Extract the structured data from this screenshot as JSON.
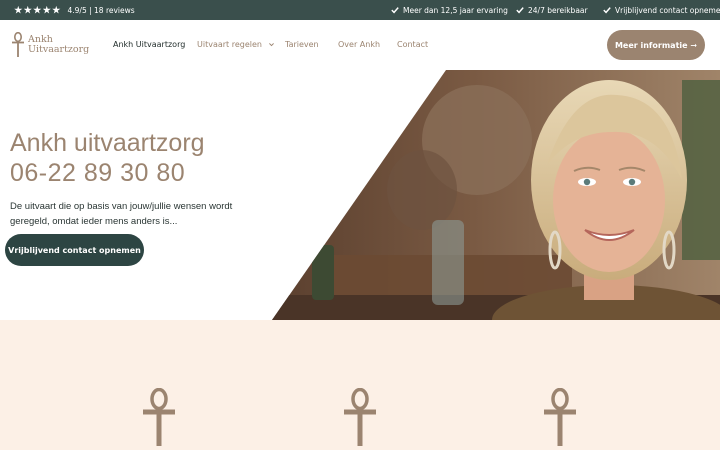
{
  "topbar": {
    "rating_text": "4.9/5 | 18 reviews",
    "stars": 5,
    "usps": [
      "Meer dan 12,5 jaar ervaring",
      "24/7 bereikbaar",
      "Vrijblijvend contact opnemen"
    ]
  },
  "logo": {
    "line1": "Ankh",
    "line2": "Uitvaartzorg"
  },
  "nav": {
    "items": [
      {
        "label": "Ankh Uitvaartzorg"
      },
      {
        "label": "Uitvaart regelen"
      },
      {
        "label": "Tarieven"
      },
      {
        "label": "Over Ankh"
      },
      {
        "label": "Contact"
      }
    ],
    "cta_label": "Meer informatie ➞"
  },
  "hero": {
    "title": "Ankh uitvaartzorg",
    "phone": "06-22 89 30 80",
    "text": "De uitvaart die op basis van jouw/jullie wensen wordt geregeld, omdat ieder mens anders is...",
    "button_label": "Vrijblijvend contact opnemen"
  },
  "colors": {
    "topbar_bg": "#3a4f4c",
    "brand_brown": "#9b8470",
    "dark_green": "#2d4543",
    "cream": "#fcf0e6"
  }
}
